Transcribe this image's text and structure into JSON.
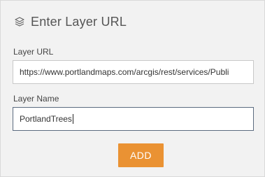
{
  "header": {
    "icon": "layers-icon",
    "title": "Enter Layer URL"
  },
  "form": {
    "url_label": "Layer URL",
    "url_value": "https://www.portlandmaps.com/arcgis/rest/services/Publi",
    "name_label": "Layer Name",
    "name_value": "PortlandTrees"
  },
  "actions": {
    "add_label": "ADD",
    "add_color": "#ea9233"
  }
}
